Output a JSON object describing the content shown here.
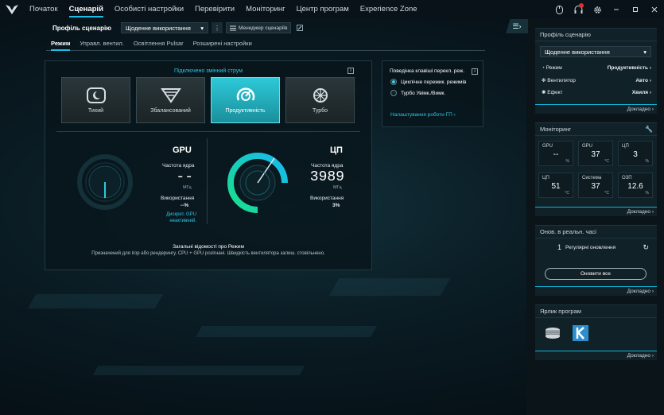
{
  "nav": {
    "tabs": [
      "Початок",
      "Сценарій",
      "Особисті настройки",
      "Перевірити",
      "Моніторинг",
      "Центр програм",
      "Experience Zone"
    ],
    "active": "Сценарій"
  },
  "profile": {
    "label": "Профіль сценарію",
    "value": "Щоденне використання",
    "manager_label": "Менеджер сценаріїв"
  },
  "subtabs": [
    "Режим",
    "Управл. вентил.",
    "Освітлення Pulsar",
    "Розширені настройки"
  ],
  "modes": {
    "title": "Підключено змінний струм",
    "items": [
      {
        "label": "Тихий",
        "icon": "quiet-icon"
      },
      {
        "label": "Збалансований",
        "icon": "balanced-icon"
      },
      {
        "label": "Продуктивність",
        "icon": "performance-icon"
      },
      {
        "label": "Турбо",
        "icon": "turbo-icon"
      }
    ],
    "active": "Продуктивність"
  },
  "gpu": {
    "title": "GPU",
    "freq_label": "Частота ядра",
    "freq_value": "--",
    "freq_unit": "МГц",
    "usage_label": "Використання",
    "usage_value": "--%",
    "note": "Дискрет. GPU неактивний."
  },
  "cpu": {
    "title": "ЦП",
    "freq_label": "Частота ядра",
    "freq_value": "3989",
    "freq_unit": "МГц",
    "usage_label": "Використання",
    "usage_value": "3%",
    "usage_fraction": 0.03
  },
  "mode_info": {
    "title": "Загальні відомості про Режим",
    "description": "Призначений для ігор або рендерингу. CPU + GPU розігнані. Швидкість вентилятора залиш. стовільнено."
  },
  "hotkey": {
    "title": "Поведінка клавіші перекл. реж.",
    "options": [
      "Циклічне перемик. режимів",
      "Турбо Увімк./Вимк."
    ],
    "selected": 0,
    "link": "Налаштування роботи ГП"
  },
  "side_profile": {
    "header": "Профіль сценарію",
    "select": "Щоденне використання",
    "rows": [
      {
        "label": "Режим",
        "value": "Продуктивність"
      },
      {
        "label": "Вентилятор",
        "value": "Авто"
      },
      {
        "label": "Ефект",
        "value": "Хвиля"
      }
    ],
    "more": "Докладно"
  },
  "side_monitor": {
    "header": "Моніторинг",
    "tiles": [
      {
        "label": "GPU",
        "value": "--",
        "unit": "%"
      },
      {
        "label": "GPU",
        "value": "37",
        "unit": "°C"
      },
      {
        "label": "ЦП",
        "value": "3",
        "unit": "%"
      },
      {
        "label": "ЦП",
        "value": "51",
        "unit": "°C"
      },
      {
        "label": "Система",
        "value": "37",
        "unit": "°C"
      },
      {
        "label": "ОЗП",
        "value": "12.6",
        "unit": "%"
      }
    ],
    "more": "Докладно"
  },
  "side_updates": {
    "header": "Онов. в реальн. часі",
    "count": "1",
    "label": "Регулярні оновлення",
    "button": "Оновити все",
    "more": "Докладно"
  },
  "side_shortcuts": {
    "header": "Ярлик програм",
    "more": "Докладно"
  },
  "colors": {
    "accent": "#1ac0e8",
    "active_mode": "#2ec9d9"
  }
}
